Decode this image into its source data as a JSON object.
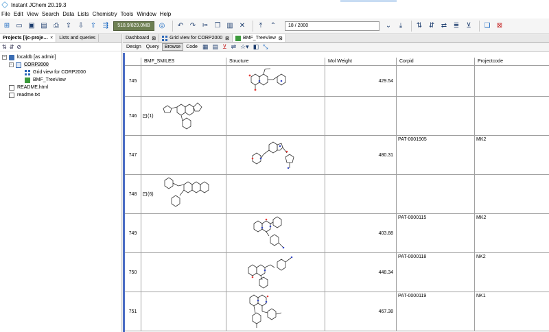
{
  "window": {
    "title": "Instant JChem 20.19.3"
  },
  "menu": [
    "File",
    "Edit",
    "View",
    "Search",
    "Data",
    "Lists",
    "Chemistry",
    "Tools",
    "Window",
    "Help"
  ],
  "toolbar": {
    "memory": "518.9/829.0MB",
    "record_nav": "18 / 2000"
  },
  "left_panel": {
    "tabs": [
      "Projects [ijc-proje…",
      "Lists and queries"
    ],
    "tree": [
      {
        "label": "localdb [as admin]",
        "icon": "database-icon"
      },
      {
        "label": "CORP2000",
        "icon": "table-icon"
      },
      {
        "label": "Grid view for CORP2000",
        "icon": "grid-view-icon"
      },
      {
        "label": "BMF_TreeView",
        "icon": "tree-view-icon"
      },
      {
        "label": "README.html",
        "icon": "document-icon"
      },
      {
        "label": "readme.txt",
        "icon": "document-icon"
      }
    ]
  },
  "doc_tabs": [
    {
      "label": "Dashboard",
      "active": false
    },
    {
      "label": "Grid view for CORP2000",
      "active": false
    },
    {
      "label": "BMF_TreeView",
      "active": true
    }
  ],
  "view_modes": [
    "Design",
    "Query",
    "Browse",
    "Code"
  ],
  "active_mode": "Browse",
  "grid": {
    "columns": [
      "BMF_SMILES",
      "Structure",
      "Mol Weight",
      "Corpid",
      "Projectcode"
    ],
    "rows": [
      {
        "id": "745",
        "smiles_count": "",
        "mol_weight": "429.54",
        "corpid": "",
        "projectcode": ""
      },
      {
        "id": "746",
        "smiles_count": "(1)",
        "mol_weight": "",
        "corpid": "",
        "projectcode": ""
      },
      {
        "id": "747",
        "smiles_count": "",
        "mol_weight": "480.31",
        "corpid": "PAT-0001905",
        "projectcode": "MK2"
      },
      {
        "id": "748",
        "smiles_count": "(6)",
        "mol_weight": "",
        "corpid": "",
        "projectcode": ""
      },
      {
        "id": "749",
        "smiles_count": "",
        "mol_weight": "403.88",
        "corpid": "PAT-0000115",
        "projectcode": "MK2"
      },
      {
        "id": "750",
        "smiles_count": "",
        "mol_weight": "448.34",
        "corpid": "PAT-0000118",
        "projectcode": "NK2"
      },
      {
        "id": "751",
        "smiles_count": "",
        "mol_weight": "467.38",
        "corpid": "PAT-0000119",
        "projectcode": "NK1"
      }
    ]
  },
  "colors": {
    "accent": "#4a6cc4",
    "memory_bar": "#6d7f52",
    "oxygen": "#e53935",
    "nitrogen": "#3346c4"
  }
}
